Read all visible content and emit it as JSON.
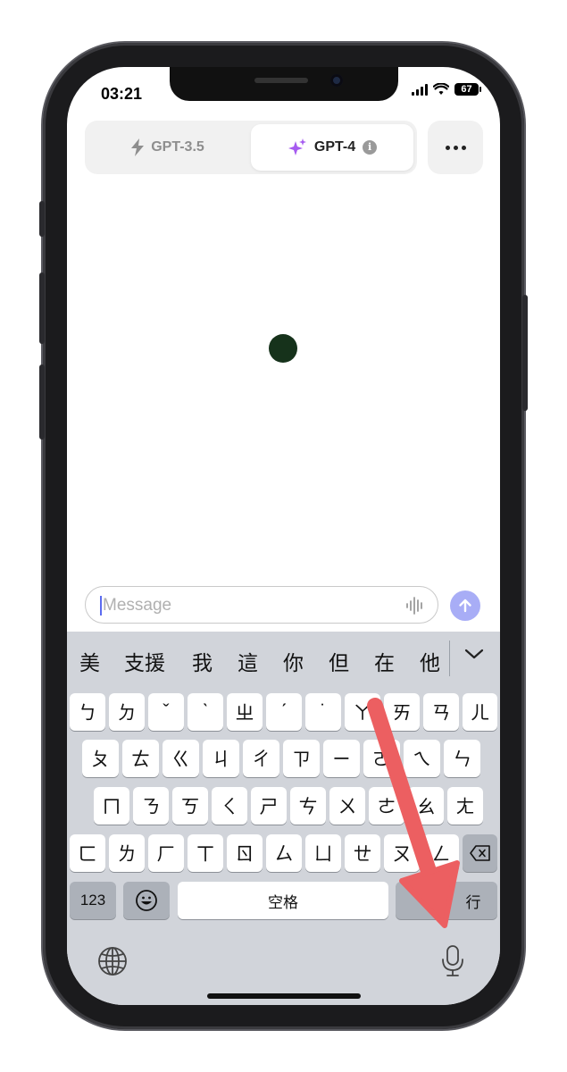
{
  "status_bar": {
    "time": "03:21",
    "battery": "67"
  },
  "model_switcher": {
    "tabs": [
      {
        "label": "GPT-3.5",
        "icon": "bolt-icon",
        "selected": false
      },
      {
        "label": "GPT-4",
        "icon": "sparkle-icon",
        "selected": true,
        "info": "i"
      }
    ]
  },
  "composer": {
    "placeholder": "Message"
  },
  "colors": {
    "accent": "#a8adf6",
    "sparkle": "#a65bf0",
    "dot": "#16321b",
    "annotation_arrow": "#ec5f61"
  },
  "keyboard": {
    "candidates": [
      "美",
      "支援",
      "我",
      "這",
      "你",
      "但",
      "在",
      "他"
    ],
    "rows": [
      [
        "ㄅ",
        "ㄉ",
        "ˇ",
        "ˋ",
        "ㄓ",
        "ˊ",
        "˙",
        "ㄚ",
        "ㄞ",
        "ㄢ",
        "ㄦ"
      ],
      [
        "ㄆ",
        "ㄊ",
        "ㄍ",
        "ㄐ",
        "ㄔ",
        "ㄗ",
        "ㄧ",
        "ㄛ",
        "ㄟ",
        "ㄣ"
      ],
      [
        "ㄇ",
        "ㄋ",
        "ㄎ",
        "ㄑ",
        "ㄕ",
        "ㄘ",
        "ㄨ",
        "ㄜ",
        "ㄠ",
        "ㄤ"
      ],
      [
        "ㄈ",
        "ㄌ",
        "ㄏ",
        "ㄒ",
        "ㄖ",
        "ㄙ",
        "ㄩ",
        "ㄝ",
        "ㄡ",
        "ㄥ"
      ]
    ],
    "numbers_key": "123",
    "space_key": "空格",
    "return_key": "行"
  }
}
